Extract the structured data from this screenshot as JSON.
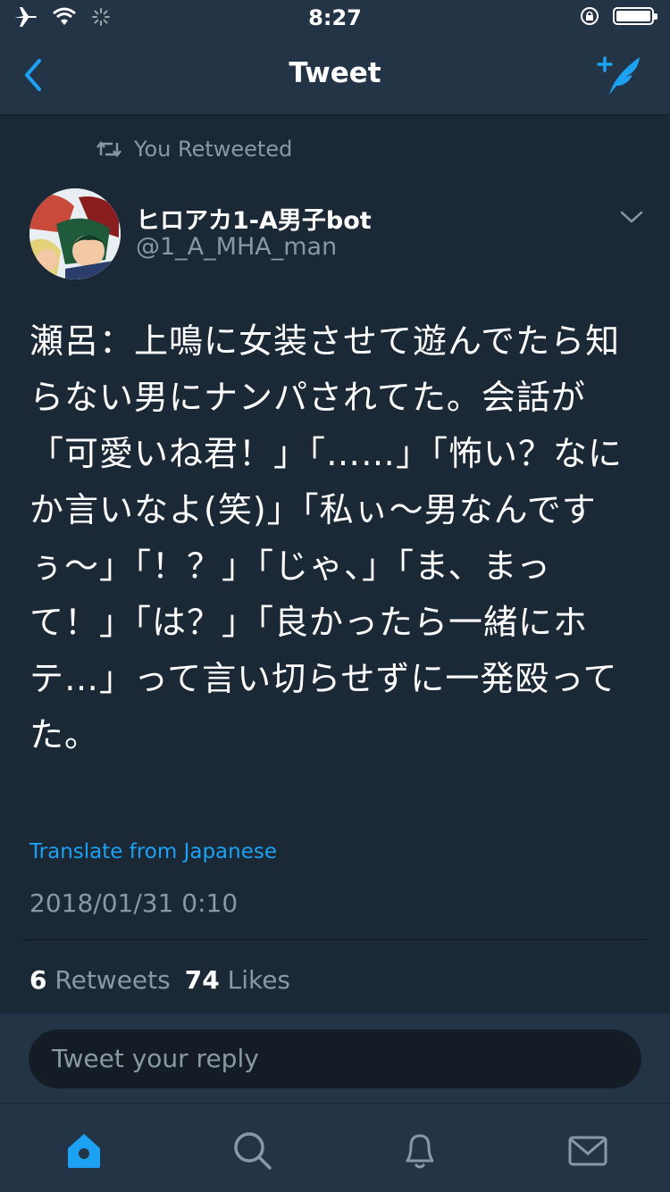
{
  "status": {
    "time": "8:27",
    "icons": [
      "airplane-icon",
      "wifi-icon",
      "activity-spinner-icon",
      "rotation-lock-icon",
      "battery-icon"
    ]
  },
  "nav": {
    "title": "Tweet",
    "back_icon": "chevron-left-icon",
    "compose_icon": "compose-tweet-icon"
  },
  "tweet": {
    "retweet_label": "You Retweeted",
    "author_name": "ヒロアカ1-A男子bot",
    "author_handle": "@1_A_MHA_man",
    "text": "瀬呂：上鳴に女装させて遊んでたら知らない男にナンパされてた。会話が「可愛いね君！」「……」「怖い？なにか言いなよ(笑)」「私ぃ〜男なんですぅ〜」「！？」「じゃ、」「ま、まって！」「は？」「良かったら一緒にホテ…」って言い切らせずに一発殴ってた。",
    "translate_label": "Translate from Japanese",
    "timestamp": "2018/01/31 0:10",
    "retweets_count": "6",
    "retweets_label": "Retweets",
    "likes_count": "74",
    "likes_label": "Likes"
  },
  "reply": {
    "placeholder": "Tweet your reply"
  },
  "tabs": [
    {
      "icon": "home-icon",
      "active": true
    },
    {
      "icon": "search-icon",
      "active": false
    },
    {
      "icon": "notifications-bell-icon",
      "active": false
    },
    {
      "icon": "messages-envelope-icon",
      "active": false
    }
  ],
  "colors": {
    "background": "#1b2836",
    "bar": "#243447",
    "accent": "#1da1f2",
    "secondary_text": "#8899a6"
  }
}
